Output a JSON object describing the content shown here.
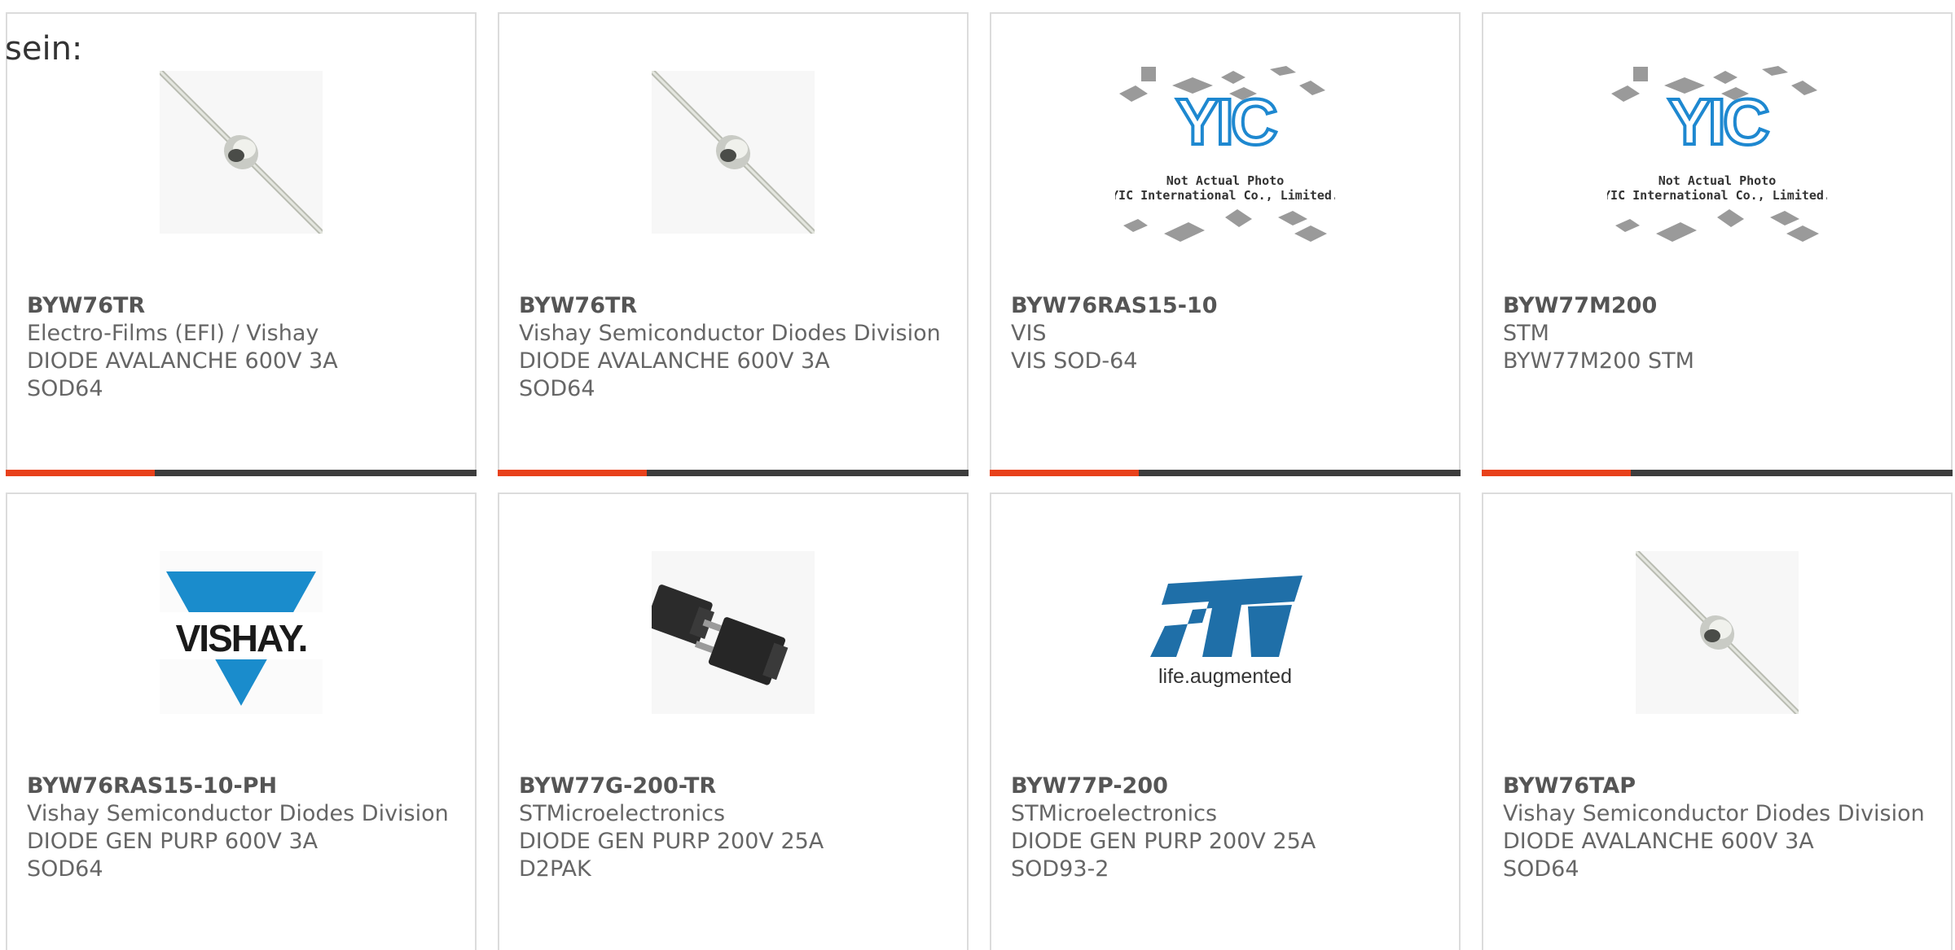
{
  "lead_text": "sein:",
  "colors": {
    "accent": "#e8411b",
    "bar": "#3d3d3d",
    "border": "#dcdcdc",
    "text": "#666666",
    "vishay_blue": "#1a8ccc",
    "st_blue": "#1f6fa8",
    "yic_blue": "#1e88d0"
  },
  "products": [
    {
      "part": "BYW76TR",
      "maker": "Electro-Films (EFI) / Vishay",
      "desc": "DIODE AVALANCHE 600V 3A",
      "pkg": "SOD64",
      "image": "axial-diode-photo"
    },
    {
      "part": "BYW76TR",
      "maker": "Vishay Semiconductor Diodes Division",
      "desc": "DIODE AVALANCHE 600V 3A",
      "pkg": "SOD64",
      "image": "axial-diode-photo"
    },
    {
      "part": "BYW76RAS15-10",
      "maker": "VIS",
      "desc": "VIS SOD-64",
      "pkg": "",
      "image": "yic-placeholder",
      "image_caption_1": "Not Actual Photo",
      "image_caption_2": "YIC International Co., Limited."
    },
    {
      "part": "BYW77M200",
      "maker": "STM",
      "desc": "BYW77M200 STM",
      "pkg": "",
      "image": "yic-placeholder",
      "image_caption_1": "Not Actual Photo",
      "image_caption_2": "YIC International Co., Limited."
    },
    {
      "part": "BYW76RAS15-10-PH",
      "maker": "Vishay Semiconductor Diodes Division",
      "desc": "DIODE GEN PURP 600V 3A",
      "pkg": "SOD64",
      "image": "vishay-logo",
      "image_caption_1": "VISHAY."
    },
    {
      "part": "BYW77G-200-TR",
      "maker": "STMicroelectronics",
      "desc": "DIODE GEN PURP 200V 25A",
      "pkg": "D2PAK",
      "image": "d2pak-photo"
    },
    {
      "part": "BYW77P-200",
      "maker": "STMicroelectronics",
      "desc": "DIODE GEN PURP 200V 25A",
      "pkg": "SOD93-2",
      "image": "st-logo",
      "image_caption_1": "life.augmented"
    },
    {
      "part": "BYW76TAP",
      "maker": "Vishay Semiconductor Diodes Division",
      "desc": "DIODE AVALANCHE 600V 3A",
      "pkg": "SOD64",
      "image": "axial-diode-photo"
    }
  ]
}
